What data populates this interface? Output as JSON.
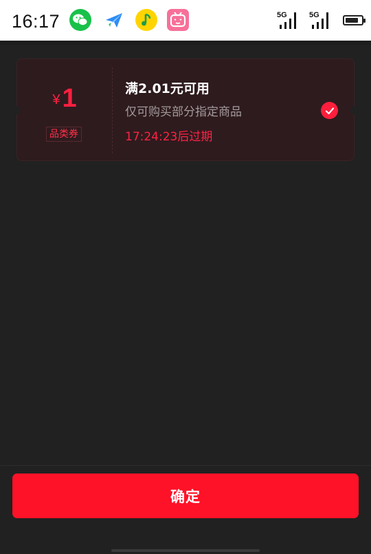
{
  "status_bar": {
    "time": "16:17",
    "network_a": "5G",
    "network_b": "5G",
    "icons": [
      "wechat-icon",
      "plane-icon",
      "music-icon",
      "bili-icon",
      "signal-icon",
      "battery-icon"
    ]
  },
  "coupon": {
    "currency": "¥",
    "amount": "1",
    "type": "品类券",
    "title": "满2.01元可用",
    "description": "仅可购买部分指定商品",
    "expiry": "17:24:23后过期",
    "selected": true,
    "accent_color": "#ff1e3c"
  },
  "footer": {
    "confirm_label": "确定"
  }
}
